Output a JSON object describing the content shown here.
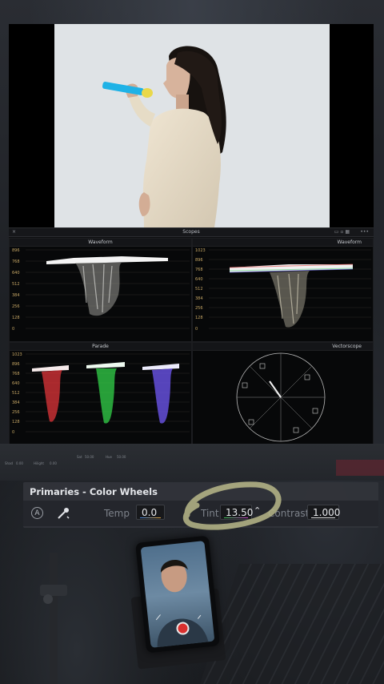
{
  "scopes": {
    "title": "Scopes",
    "panels": {
      "waveform_left": {
        "title": "Waveform",
        "ticks": [
          "896",
          "768",
          "640",
          "512",
          "384",
          "256",
          "128",
          "0"
        ]
      },
      "waveform_right": {
        "title": "Waveform",
        "ticks": [
          "1023",
          "896",
          "768",
          "640",
          "512",
          "384",
          "256",
          "128",
          "0"
        ]
      },
      "parade": {
        "title": "Parade",
        "ticks": [
          "1023",
          "896",
          "768",
          "640",
          "512",
          "384",
          "256",
          "128",
          "0"
        ]
      },
      "vectorscope": {
        "title": "Vectorscope"
      }
    }
  },
  "strip": {
    "labels": [
      "Shad",
      "0.00",
      "Hilight",
      "0.00",
      "Sat",
      "50.00",
      "Hue",
      "50.00"
    ]
  },
  "primaries": {
    "title": "Primaries - Color Wheels",
    "auto_label": "A",
    "temp_label": "Temp",
    "temp_value": "0.0",
    "tint_label": "Tint",
    "tint_value": "13.50",
    "contrast_label": "Contrast",
    "contrast_value": "1.000"
  },
  "colors": {
    "panel_bg": "#31343a",
    "highlight_circle": "#b9b98a",
    "record_button": "#d9302e",
    "parade_red": "#e0343a",
    "parade_green": "#33d14a",
    "parade_blue": "#6a54e8"
  },
  "icons": [
    "auto-icon",
    "color-picker-icon",
    "spinner-up-icon",
    "window-menu-icon",
    "layout-icon",
    "record-icon"
  ]
}
